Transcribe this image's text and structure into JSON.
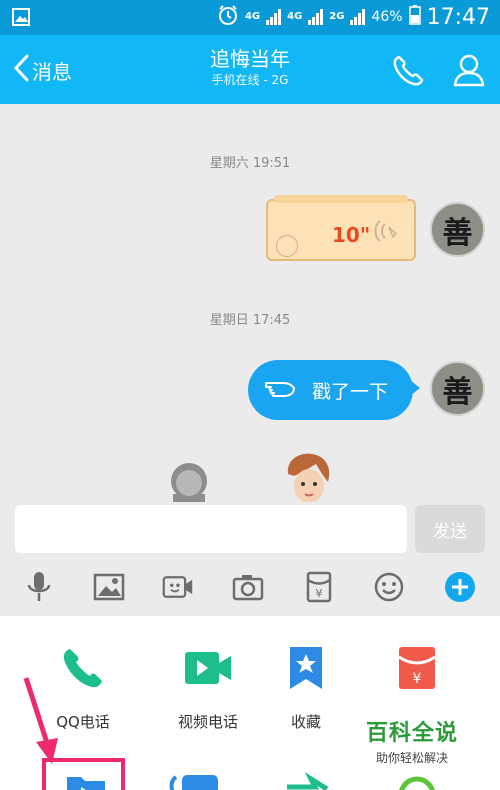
{
  "status_bar": {
    "network_1": "4G",
    "network_2": "4G",
    "network_3": "2G",
    "battery": "46%",
    "time": "17:47"
  },
  "header": {
    "back_label": "消息",
    "title": "追悔当年",
    "subtitle": "手机在线 - 2G"
  },
  "chat": {
    "messages": [
      {
        "timestamp": "星期六 19:51",
        "type": "voice",
        "duration": "10\""
      },
      {
        "timestamp": "星期日 17:45",
        "type": "poke",
        "text": "戳了一下"
      }
    ],
    "avatar_char": "善"
  },
  "input": {
    "value": "",
    "send_label": "发送"
  },
  "toolbar": {
    "icons": [
      "microphone-icon",
      "image-icon",
      "video-icon",
      "camera-icon",
      "red-packet-icon",
      "emoji-icon",
      "plus-icon"
    ]
  },
  "panel": {
    "features": [
      {
        "label": "QQ电话",
        "icon": "phone-icon",
        "color": "#1dbd8c"
      },
      {
        "label": "视频电话",
        "icon": "video-call-icon",
        "color": "#1dbd8c"
      },
      {
        "label": "收藏",
        "icon": "favorite-icon",
        "color": "#2d8be6"
      },
      {
        "label": "",
        "icon": "red-packet-icon",
        "color": "#f05a4a"
      }
    ]
  },
  "watermark": {
    "title": "百科全说",
    "subtitle": "助你轻松解决"
  },
  "colors": {
    "header": "#12b7f5",
    "status_bar": "#0b9ad8",
    "bubble": "#1aa5f0",
    "highlight": "#ee2a6a"
  }
}
